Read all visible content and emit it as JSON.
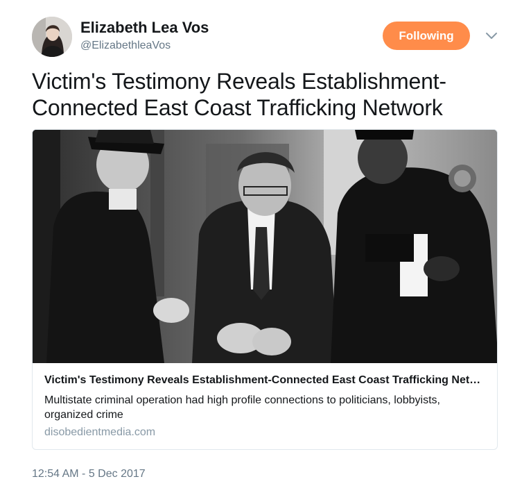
{
  "author": {
    "display_name": "Elizabeth Lea Vos",
    "handle": "@ElizabethleaVos"
  },
  "follow_button": {
    "label": "Following",
    "color": "#ff8c4a"
  },
  "menu": {
    "icon": "chevron-down-icon"
  },
  "tweet": {
    "text": "Victim's Testimony Reveals Establishment-Connected East Coast Trafficking Network",
    "timestamp": "12:54 AM - 5 Dec 2017"
  },
  "card": {
    "image": "black-and-white photo of a handcuffed man in a suit escorted by two police officers",
    "title": "Victim's Testimony Reveals Establishment-Connected East Coast Trafficking Network",
    "description": "Multistate criminal operation had high profile connections to politicians, lobbyists, organized crime",
    "domain": "disobedientmedia.com"
  },
  "colors": {
    "name": "#14171a",
    "secondary": "#657786",
    "domain": "#8899a6",
    "card_border": "#e1e8ed"
  }
}
